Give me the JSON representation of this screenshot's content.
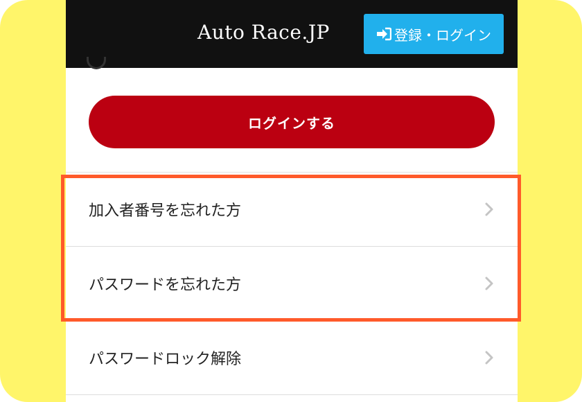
{
  "header": {
    "brand": "Auto Race.JP",
    "login_button": "登録・ログイン",
    "login_icon": "sign-in-icon"
  },
  "main": {
    "login_button": "ログインする"
  },
  "menu": {
    "items": [
      {
        "label": "加入者番号を忘れた方",
        "icon": "chevron-right-icon"
      },
      {
        "label": "パスワードを忘れた方",
        "icon": "chevron-right-icon"
      },
      {
        "label": "パスワードロック解除",
        "icon": "chevron-right-icon"
      }
    ]
  },
  "colors": {
    "background": "#fff56a",
    "header": "#111111",
    "header_button": "#21b0ec",
    "primary": "#bb0011",
    "highlight": "#ff5a2a"
  }
}
